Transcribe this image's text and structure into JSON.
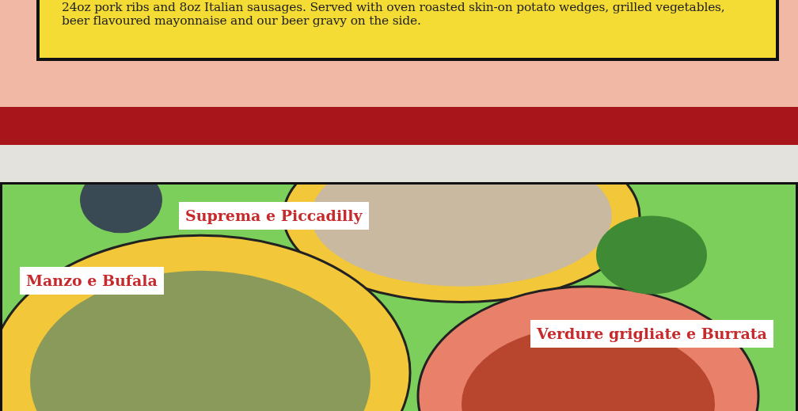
{
  "menu_item": {
    "description": "24oz pork ribs and 8oz Italian sausages. Served with oven roasted skin-on potato wedges, grilled vegetables, beer flavoured mayonnaise and our beer gravy on the side."
  },
  "photo": {
    "labels": [
      {
        "text": "Suprema e Piccadilly"
      },
      {
        "text": "Manzo e Bufala"
      },
      {
        "text": "Verdure grigliate e Burrata"
      }
    ]
  }
}
